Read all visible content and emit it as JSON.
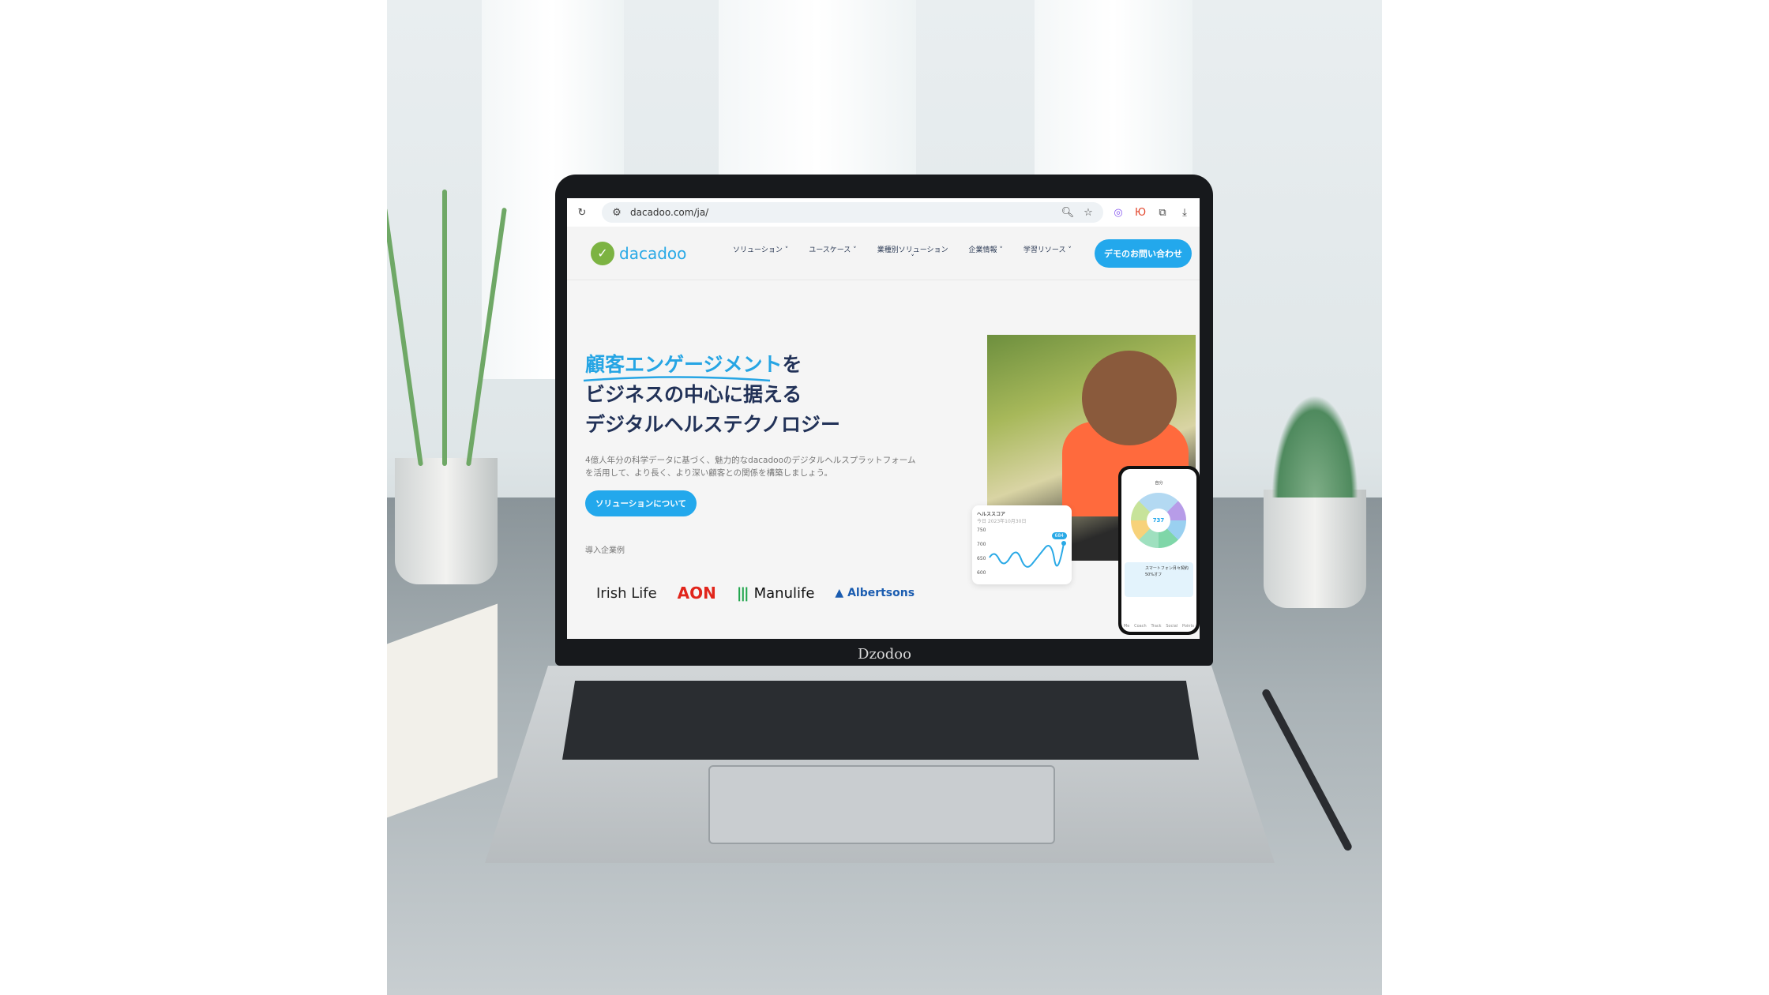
{
  "browser": {
    "url": "dacadoo.com/ja/",
    "icons": [
      "reload-icon",
      "site-settings-icon",
      "zoom-icon",
      "bookmark-star-icon",
      "extension-icon",
      "yandex-icon",
      "puzzle-icon",
      "download-icon"
    ],
    "ext_label": "Ю"
  },
  "site": {
    "logo_text": "dacadoo",
    "nav": [
      {
        "label": "ソリューション"
      },
      {
        "label": "ユースケース"
      },
      {
        "label": "業種別ソリューション"
      },
      {
        "label": "企業情報"
      },
      {
        "label": "学習リソース"
      }
    ],
    "demo_button": "デモのお問い合わせ",
    "hero": {
      "highlight": "顧客エンゲージメント",
      "line1_rest": "を",
      "line2": "ビジネスの中心に据える",
      "line3": "デジタルヘルステクノロジー",
      "description": "4億人年分の科学データに基づく、魅力的なdacadooのデジタルヘルスプラットフォームを活用して、より長く、より深い顧客との関係を構築しましょう。",
      "cta": "ソリューションについて"
    },
    "clients_label": "導入企業例",
    "clients": [
      "Irish Life",
      "AON",
      "Manulife",
      "Albertsons"
    ],
    "health_card": {
      "title": "ヘルススコア",
      "date": "今日 2023年10月30日",
      "y_ticks": [
        "750",
        "700",
        "650",
        "600"
      ],
      "axis": "ヘルススコア",
      "badge": "684"
    },
    "phone": {
      "header": "自分",
      "score": "737",
      "promo_title": "スマートフォン月々契約",
      "promo_sub": "50%オフ",
      "tabs": [
        "Me",
        "Coach",
        "Track",
        "Social",
        "Points"
      ]
    }
  },
  "laptop_brand": "Dzodoo",
  "colors": {
    "accent": "#23a8ec",
    "heading": "#223258",
    "logo_green": "#7cb342"
  }
}
